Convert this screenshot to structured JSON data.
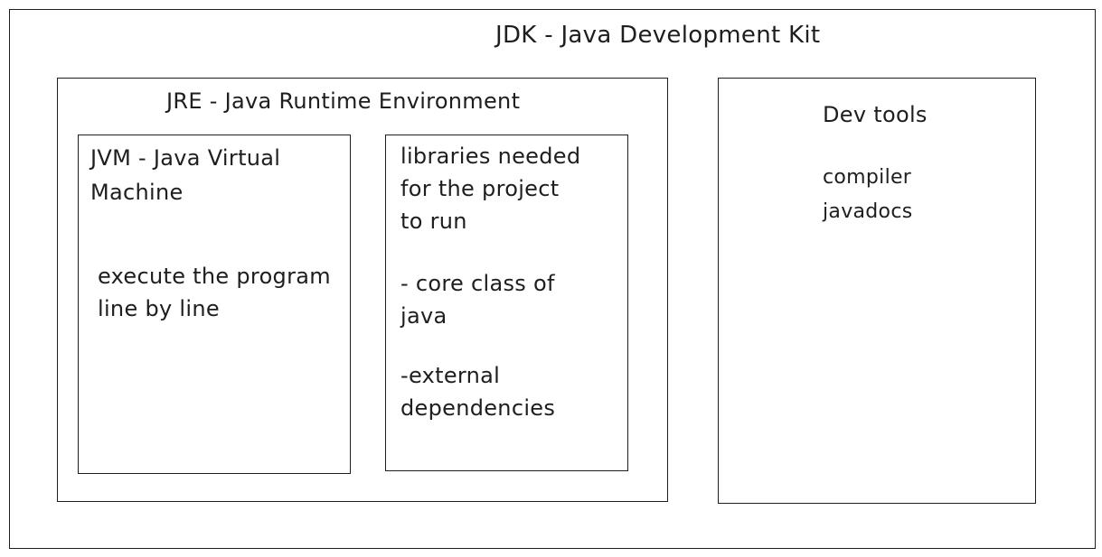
{
  "jdk": {
    "title": "JDK - Java Development Kit"
  },
  "jre": {
    "title": "JRE - Java Runtime Environment"
  },
  "jvm": {
    "title": "JVM - Java Virtual\nMachine",
    "description": "execute the program\nline by line"
  },
  "libraries": {
    "description": "libraries needed\nfor the project\nto run",
    "core": "- core class of\njava",
    "external": "-external\ndependencies"
  },
  "dev_tools": {
    "title": "Dev tools",
    "items": "compiler\njavadocs"
  }
}
